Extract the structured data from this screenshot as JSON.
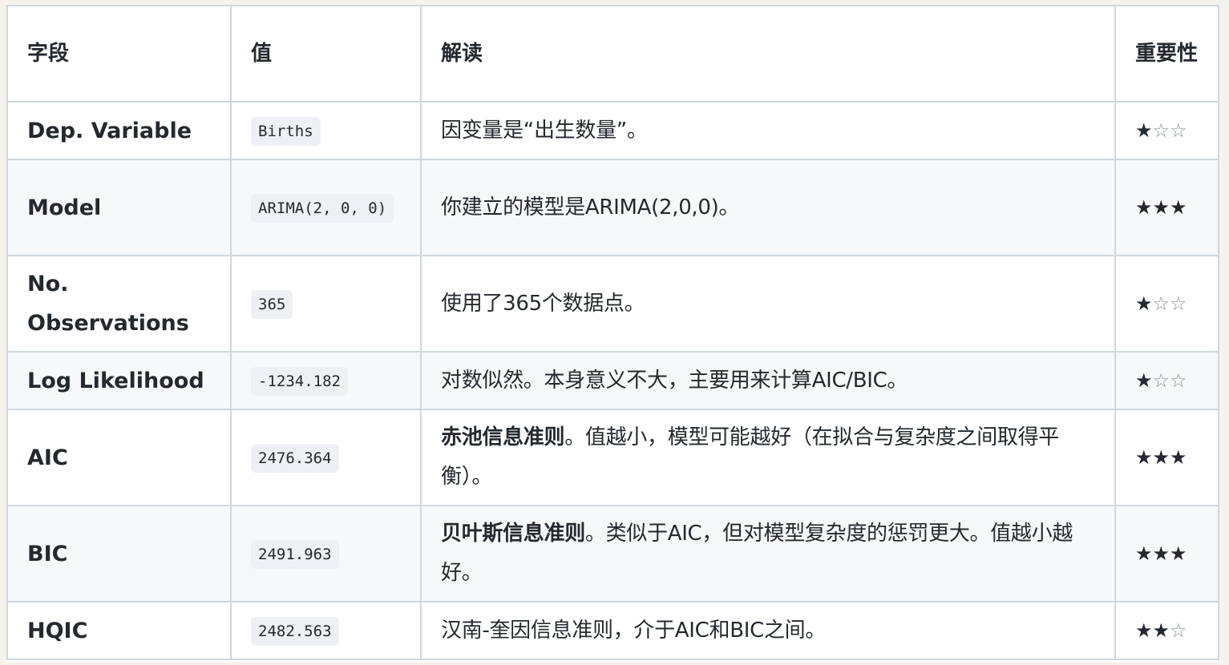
{
  "table": {
    "headers": [
      "字段",
      "值",
      "解读",
      "重要性"
    ],
    "rows": [
      {
        "field": "Dep. Variable",
        "value": "Births",
        "desc_bold": "",
        "desc": "因变量是“出生数量”。",
        "stars_full": "★",
        "stars_empty": "☆☆"
      },
      {
        "field": "Model",
        "value": "ARIMA(2, 0, 0)",
        "desc_bold": "",
        "desc": "你建立的模型是ARIMA(2,0,0)。",
        "stars_full": "★★★",
        "stars_empty": ""
      },
      {
        "field": "No. Observations",
        "value": "365",
        "desc_bold": "",
        "desc": "使用了365个数据点。",
        "stars_full": "★",
        "stars_empty": "☆☆"
      },
      {
        "field": "Log Likelihood",
        "value": "-1234.182",
        "desc_bold": "",
        "desc": "对数似然。本身意义不大，主要用来计算AIC/BIC。",
        "stars_full": "★",
        "stars_empty": "☆☆"
      },
      {
        "field": "AIC",
        "value": "2476.364",
        "desc_bold": "赤池信息准则",
        "desc": "。值越小，模型可能越好（在拟合与复杂度之间取得平衡）。",
        "stars_full": "★★★",
        "stars_empty": ""
      },
      {
        "field": "BIC",
        "value": "2491.963",
        "desc_bold": "贝叶斯信息准则",
        "desc": "。类似于AIC，但对模型复杂度的惩罚更大。值越小越好。",
        "stars_full": "★★★",
        "stars_empty": ""
      },
      {
        "field": "HQIC",
        "value": "2482.563",
        "desc_bold": "",
        "desc": "汉南-奎因信息准则，介于AIC和BIC之间。",
        "stars_full": "★★",
        "stars_empty": "☆"
      }
    ]
  }
}
